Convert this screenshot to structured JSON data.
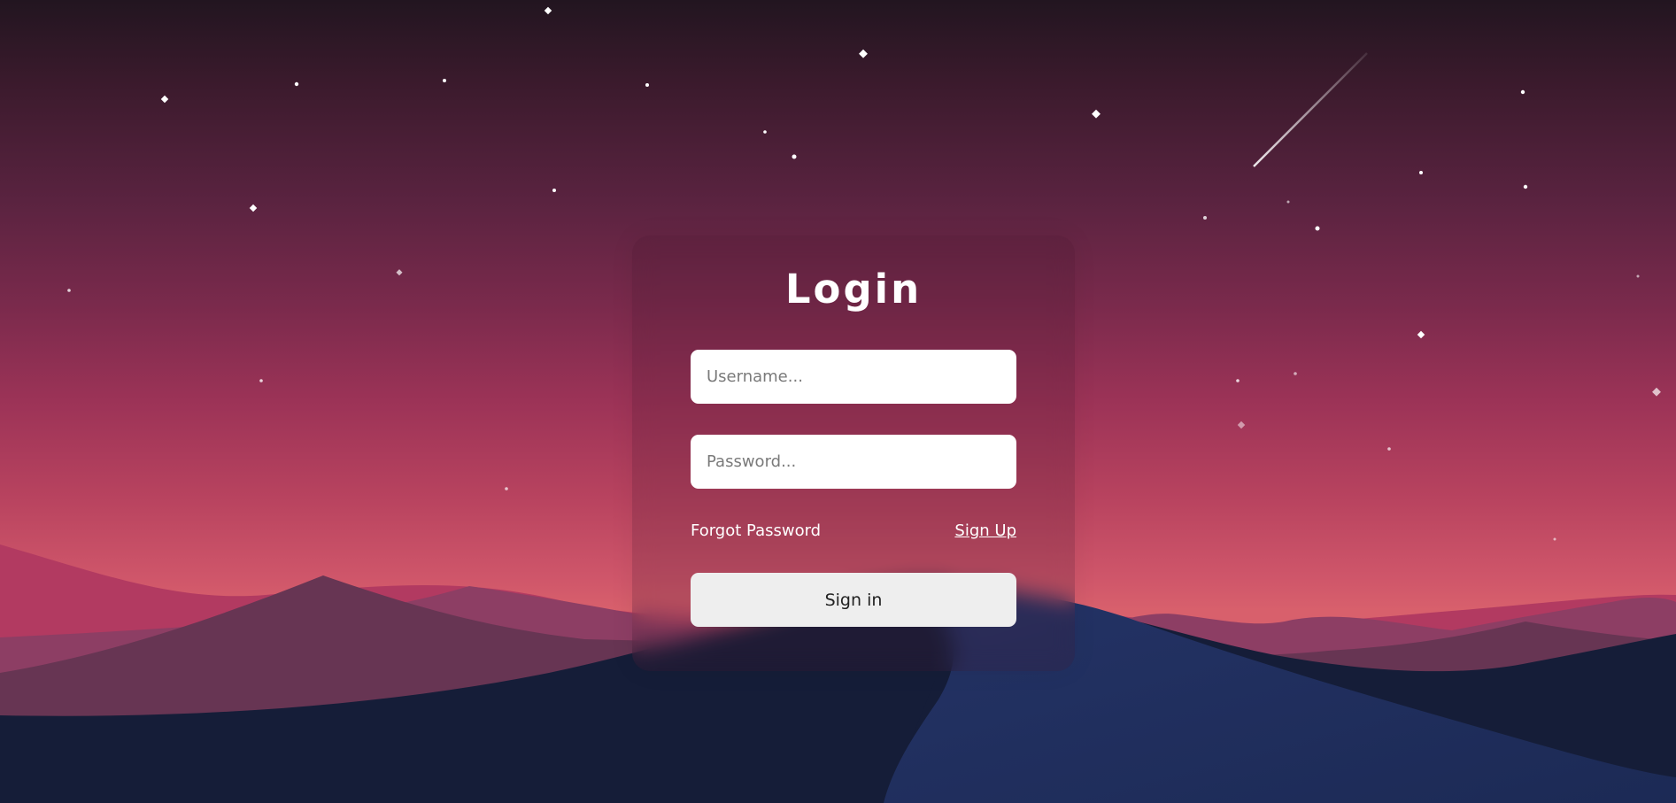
{
  "login": {
    "title": "Login",
    "username_placeholder": "Username...",
    "password_placeholder": "Password...",
    "forgot_password_label": "Forgot Password",
    "sign_up_label": "Sign Up",
    "sign_in_label": "Sign in"
  },
  "colors": {
    "sky_top": "#221520",
    "sky_bottom": "#d8606c",
    "far_hills": "#b23a61",
    "mid_hills": "#8d3e64",
    "near_hills": "#673553",
    "dune_dark": "#151d38",
    "dune_blue": "#1f2f5c",
    "card_tint": "#46192d",
    "input_bg": "#ffffff",
    "button_bg": "#eeeeee",
    "text_light": "#ffffff"
  }
}
